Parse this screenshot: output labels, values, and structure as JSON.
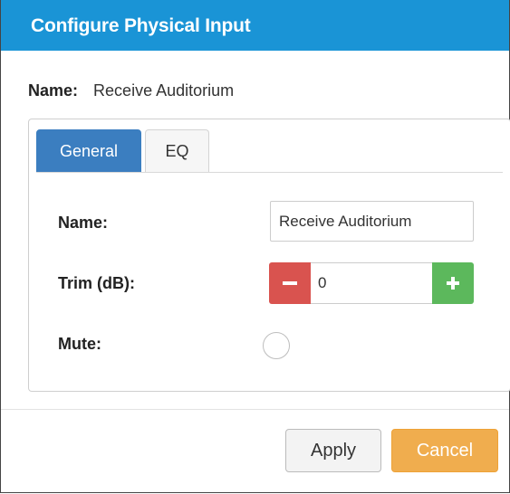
{
  "dialog": {
    "title": "Configure Physical Input",
    "header_color": "#1a94d6"
  },
  "summary": {
    "name_label": "Name:",
    "name_value": "Receive Auditorium"
  },
  "tabs": [
    {
      "label": "General",
      "active": true
    },
    {
      "label": "EQ",
      "active": false
    }
  ],
  "form": {
    "name_label": "Name:",
    "name_value": "Receive Auditorium",
    "trim_label": "Trim (dB):",
    "trim_value": "0",
    "mute_label": "Mute:",
    "mute_checked": false,
    "minus_icon": "minus-icon",
    "plus_icon": "plus-icon"
  },
  "footer": {
    "apply_label": "Apply",
    "cancel_label": "Cancel"
  },
  "colors": {
    "tab_active": "#3b7ec0",
    "decrement": "#d9534f",
    "increment": "#5cb85c",
    "cancel": "#f0ad4e"
  }
}
